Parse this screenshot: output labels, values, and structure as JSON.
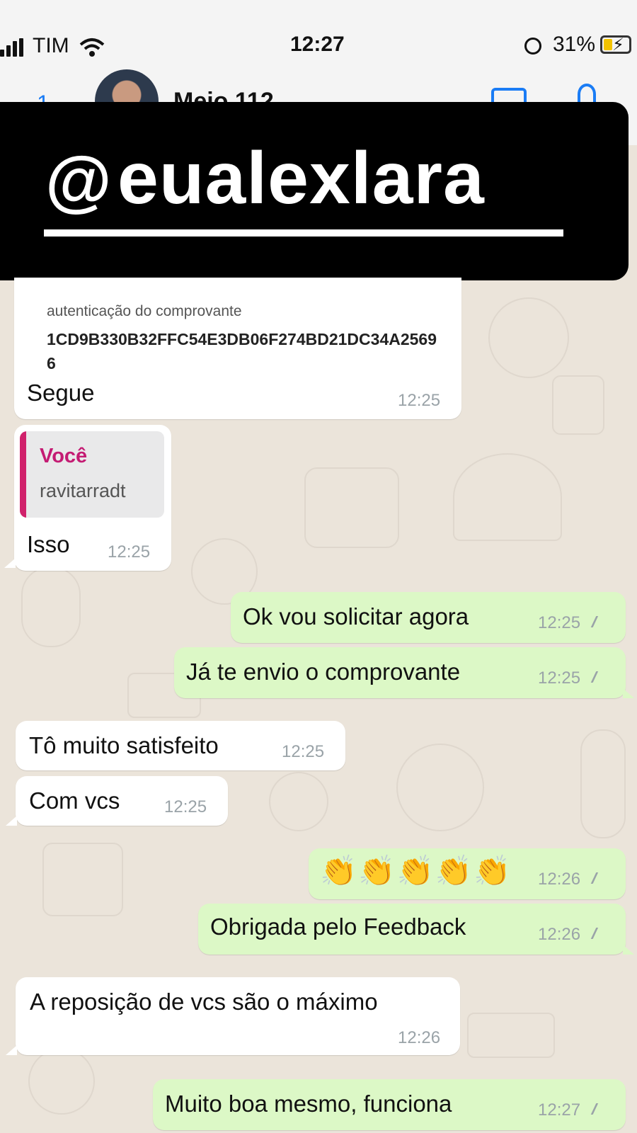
{
  "status_bar": {
    "carrier": "TIM",
    "time": "12:27",
    "battery": "31%"
  },
  "header": {
    "back_count": "1",
    "contact_name": "Meio 112"
  },
  "overlay": {
    "handle": "eualexlara"
  },
  "messages": {
    "receipt": {
      "auth_label": "autenticação do comprovante",
      "auth_code": "1CD9B330B32FFC54E3DB06F274BD21DC34A25696",
      "text": "Segue",
      "time": "12:25"
    },
    "reply": {
      "quote_author": "Você",
      "quote_text": "ravitarradt",
      "text": "Isso",
      "time": "12:25"
    },
    "m1": {
      "text": "Ok vou solicitar agora",
      "time": "12:25"
    },
    "m2": {
      "text": "Já te envio o comprovante",
      "time": "12:25"
    },
    "m3": {
      "text": "Tô muito satisfeito",
      "time": "12:25"
    },
    "m4": {
      "text": "Com vcs",
      "time": "12:25"
    },
    "m5": {
      "text": "👏👏👏👏👏",
      "time": "12:26"
    },
    "m6": {
      "text": "Obrigada pelo Feedback",
      "time": "12:26"
    },
    "m7": {
      "text": "A reposição de vcs são o máximo",
      "time": "12:26"
    },
    "m8": {
      "text": "Muito boa mesmo, funciona",
      "time": "12:27"
    }
  },
  "icons": [
    "signal-icon",
    "wifi-icon",
    "orientation-lock-icon",
    "battery-icon",
    "back-icon",
    "video-call-icon",
    "phone-icon",
    "threads-logo-icon",
    "double-check-icon"
  ],
  "colors": {
    "incoming_bubble": "#ffffff",
    "outgoing_bubble": "#dcf8c6",
    "chat_background": "#ebe4da",
    "ios_blue": "#1a7cf5",
    "quote_accent": "#c41b73"
  }
}
